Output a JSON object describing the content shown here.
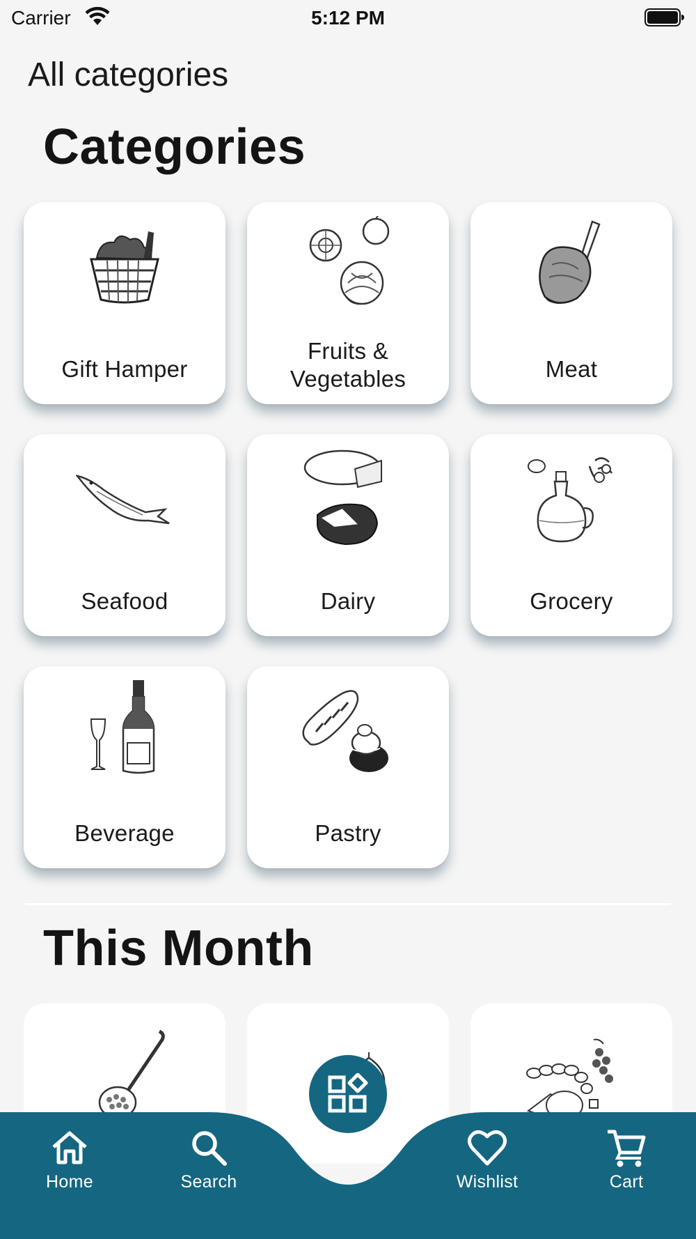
{
  "status_bar": {
    "carrier": "Carrier",
    "time": "5:12 PM"
  },
  "header": {
    "title": "All categories"
  },
  "categories_section": {
    "title": "Categories",
    "items": [
      {
        "label": "Gift Hamper",
        "icon": "gift-basket-icon"
      },
      {
        "label": "Fruits & Vegetables",
        "icon": "fruits-vegetables-icon"
      },
      {
        "label": "Meat",
        "icon": "meat-icon"
      },
      {
        "label": "Seafood",
        "icon": "fish-icon"
      },
      {
        "label": "Dairy",
        "icon": "cheese-icon"
      },
      {
        "label": "Grocery",
        "icon": "oil-bottle-icon"
      },
      {
        "label": "Beverage",
        "icon": "champagne-icon"
      },
      {
        "label": "Pastry",
        "icon": "bread-pastry-icon"
      }
    ]
  },
  "this_month_section": {
    "title": "This Month",
    "items": [
      {
        "icon": "caviar-spoon-icon"
      },
      {
        "icon": "citrus-onion-icon"
      },
      {
        "icon": "sausage-cheese-icon"
      }
    ]
  },
  "tab_bar": {
    "items": [
      {
        "label": "Home",
        "icon": "home-icon"
      },
      {
        "label": "Search",
        "icon": "search-icon"
      },
      {
        "label": "Wishlist",
        "icon": "heart-icon"
      },
      {
        "label": "Cart",
        "icon": "cart-icon"
      }
    ],
    "center_icon": "categories-icon"
  },
  "colors": {
    "background": "#f5f5f5",
    "card": "#ffffff",
    "tab_bar": "#156681",
    "text": "#1a1a1a"
  }
}
